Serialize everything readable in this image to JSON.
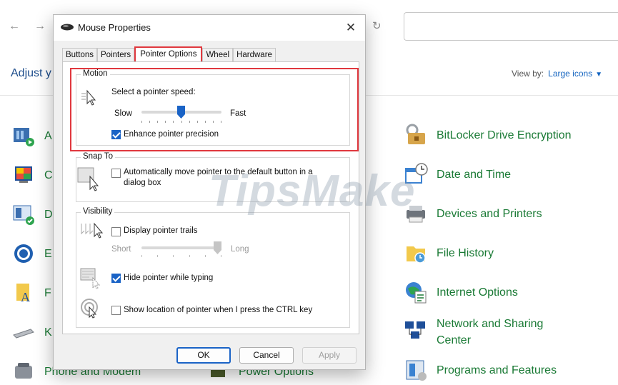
{
  "control_panel": {
    "heading": "Adjust y",
    "view_by_label": "View by:",
    "view_by_value": "Large icons",
    "left_items": [
      "A",
      "C",
      "D",
      "E",
      "F",
      "K"
    ],
    "bottom_items": [
      "Phone and Modem",
      "Power Options"
    ],
    "right_items": [
      {
        "label": "BitLocker Drive Encryption",
        "icon": "bitlocker-icon"
      },
      {
        "label": "Date and Time",
        "icon": "date-time-icon"
      },
      {
        "label": "Devices and Printers",
        "icon": "devices-printers-icon"
      },
      {
        "label": "File History",
        "icon": "file-history-icon"
      },
      {
        "label": "Internet Options",
        "icon": "internet-options-icon"
      },
      {
        "label": "Network and Sharing Center",
        "icon": "network-sharing-icon"
      },
      {
        "label": "Programs and Features",
        "icon": "programs-features-icon"
      }
    ]
  },
  "dialog": {
    "title": "Mouse Properties",
    "tabs": [
      "Buttons",
      "Pointers",
      "Pointer Options",
      "Wheel",
      "Hardware"
    ],
    "active_tab": "Pointer Options",
    "motion": {
      "group_label": "Motion",
      "speed_label": "Select a pointer speed:",
      "slow": "Slow",
      "fast": "Fast",
      "speed_value": 0.5,
      "precision_label": "Enhance pointer precision",
      "precision_checked": true
    },
    "snap_to": {
      "group_label": "Snap To",
      "label": "Automatically move pointer to the default button in a dialog box",
      "label_line1": "Automatically move pointer to the default button in a",
      "label_line2": "dialog box",
      "checked": false
    },
    "visibility": {
      "group_label": "Visibility",
      "trails_label": "Display pointer trails",
      "trails_checked": false,
      "short": "Short",
      "long": "Long",
      "trail_value": 1.0,
      "hide_label": "Hide pointer while typing",
      "hide_checked": true,
      "ctrl_label": "Show location of pointer when I press the CTRL key",
      "ctrl_checked": false
    },
    "buttons": {
      "ok": "OK",
      "cancel": "Cancel",
      "apply": "Apply"
    }
  },
  "watermark": "TipsMake",
  "colors": {
    "accent": "#1a63c6",
    "highlight": "#e0383e",
    "link_green": "#1a7a35"
  }
}
